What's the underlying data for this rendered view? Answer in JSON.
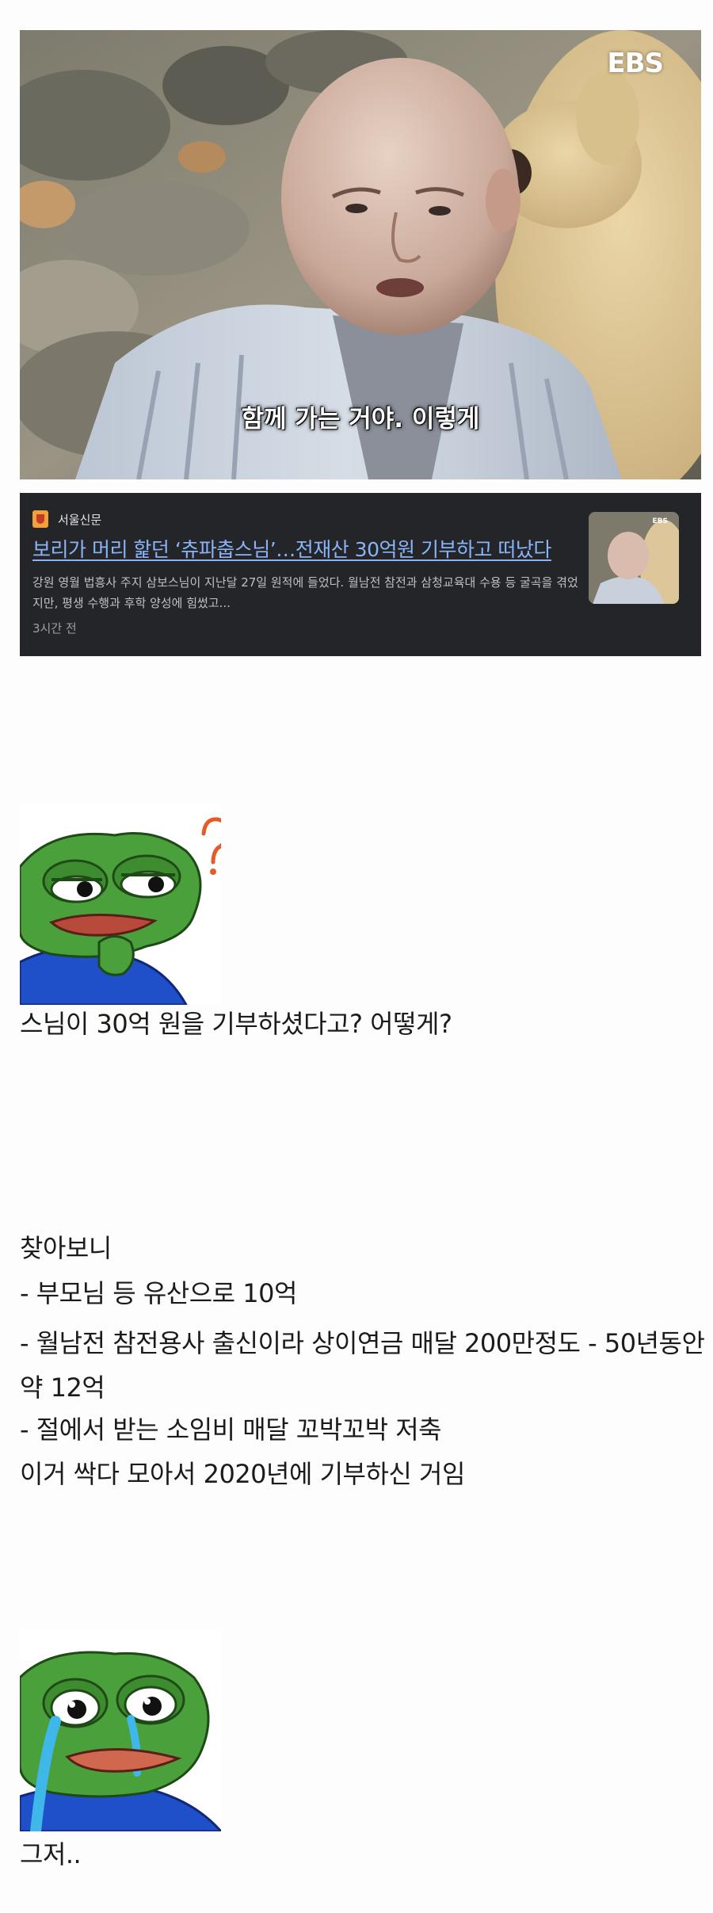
{
  "video": {
    "logo": "EBS",
    "subtitle": "함께 가는 거야. 이렇게"
  },
  "news": {
    "source": "서울신문",
    "title": "보리가 머리 핥던 ‘츄파춥스님’…전재산 30억원 기부하고 떠났다",
    "snippet": "강원 영월 법흥사 주지 삼보스님이 지난달 27일 원적에 들었다. 월남전 참전과 삼청교육대 수용 등 굴곡을 겪었지만, 평생 수행과 후학 양성에 힘썼고...",
    "time": "3시간 전",
    "thumb_logo": "EBS"
  },
  "post": {
    "question": "스님이 30억 원을 기부하셨다고? 어떻게?",
    "found": "찾아보니",
    "item1": "- 부모님 등 유산으로 10억",
    "item2": "- 월남전 참전용사 출신이라 상이연금 매달 200만정도 - 50년동안 약 12억",
    "item3": "- 절에서 받는 소임비 매달 꼬박꼬박 저축",
    "summary": "이거 싹다 모아서 2020년에 기부하신 거임",
    "ending": "그저.."
  },
  "colors": {
    "card_bg": "#242528",
    "link": "#8ab4f8",
    "pepe_green": "#4aa03a",
    "pepe_shirt": "#1f4fc9"
  }
}
